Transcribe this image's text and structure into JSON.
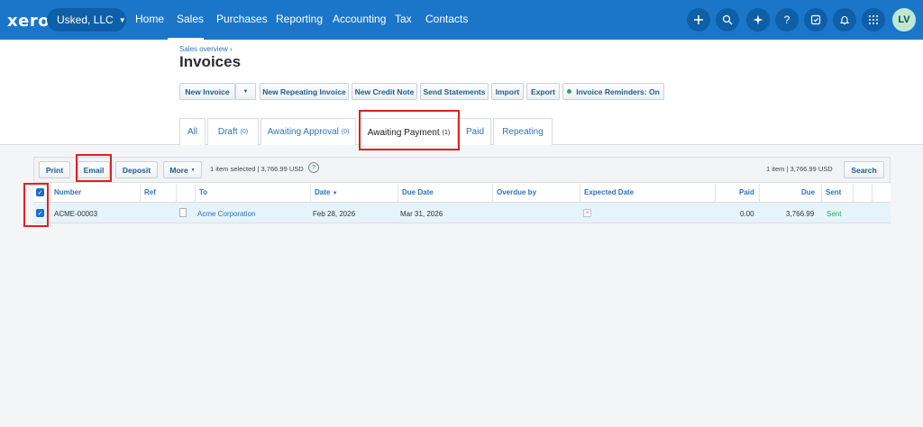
{
  "topbar": {
    "logo": "xero",
    "org": "Usked, LLC",
    "nav": [
      "Home",
      "Sales",
      "Purchases",
      "Reporting",
      "Accounting",
      "Tax",
      "Contacts"
    ],
    "avatar": "LV",
    "icons": [
      "plus-icon",
      "search-icon",
      "sparkle-icon",
      "help-icon",
      "notes-icon",
      "bell-icon",
      "apps-grid-icon"
    ]
  },
  "header": {
    "breadcrumb": "Sales overview ›",
    "title": "Invoices"
  },
  "actions": {
    "new_invoice": "New Invoice",
    "new_repeating": "New Repeating Invoice",
    "new_credit_note": "New Credit Note",
    "send_statements": "Send Statements",
    "import": "Import",
    "export": "Export",
    "reminders": "Invoice Reminders: On"
  },
  "tabs": [
    {
      "label": "All",
      "count": ""
    },
    {
      "label": "Draft",
      "count": "(0)"
    },
    {
      "label": "Awaiting Approval",
      "count": "(0)"
    },
    {
      "label": "Awaiting Payment",
      "count": "(1)"
    },
    {
      "label": "Paid",
      "count": ""
    },
    {
      "label": "Repeating",
      "count": ""
    }
  ],
  "toolbar": {
    "print": "Print",
    "email": "Email",
    "deposit": "Deposit",
    "more": "More",
    "selection": "1 item selected | 3,766.99 USD",
    "help": "?",
    "count": "1 item  | 3,766.99  USD",
    "search": "Search"
  },
  "table": {
    "headers": {
      "number": "Number",
      "ref": "Ref",
      "to": "To",
      "date": "Date",
      "due_date": "Due Date",
      "overdue_by": "Overdue by",
      "expected_date": "Expected Date",
      "paid": "Paid",
      "due": "Due",
      "sent": "Sent"
    },
    "rows": [
      {
        "number": "ACME-00003",
        "ref": "",
        "to": "Acme Corporation",
        "date": "Feb 28, 2026",
        "due_date": "Mar 31, 2026",
        "overdue_by": "",
        "paid": "0.00",
        "due": "3,766.99",
        "sent": "Sent"
      }
    ]
  },
  "colors": {
    "topbar": "#1b76c9",
    "link": "#2d74b8",
    "highlight_row": "#e6f3fa",
    "annotation_red": "#e02020"
  }
}
